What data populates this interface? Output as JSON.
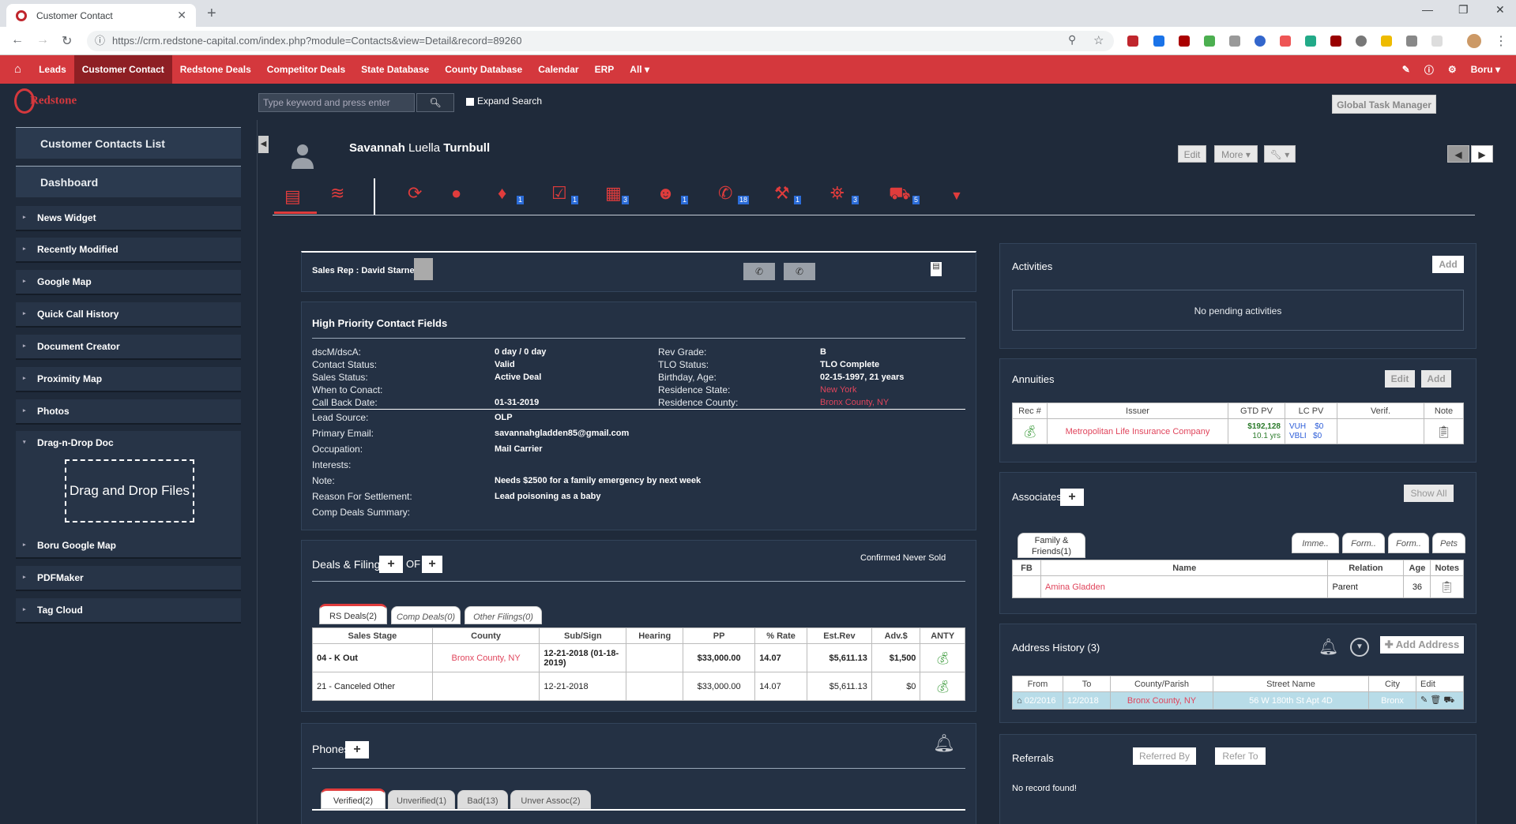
{
  "browser": {
    "tab_title": "Customer Contact",
    "url": "https://crm.redstone-capital.com/index.php?module=Contacts&view=Detail&record=89260"
  },
  "topnav": {
    "items": [
      "Leads",
      "Customer Contact",
      "Redstone Deals",
      "Competitor Deals",
      "State Database",
      "County Database",
      "Calendar",
      "ERP",
      "All"
    ],
    "user": "Boru"
  },
  "search": {
    "placeholder": "Type keyword and press enter",
    "expand_label": "Expand Search",
    "global_task": "Global Task Manager"
  },
  "logo": {
    "text": "Redstone"
  },
  "sidebar": {
    "big": [
      "Customer Contacts List",
      "Dashboard"
    ],
    "items": [
      "News Widget",
      "Recently Modified",
      "Google Map",
      "Quick Call History",
      "Document Creator",
      "Proximity Map",
      "Photos",
      "Drag-n-Drop Doc"
    ],
    "dropzone": "Drag and Drop Files",
    "items2": [
      "Boru Google Map",
      "PDFMaker",
      "Tag Cloud"
    ]
  },
  "contact": {
    "first": "Savannah",
    "middle": "Luella",
    "last": "Turnbull",
    "edit": "Edit",
    "more": "More"
  },
  "iconbar": {
    "badges": [
      "1",
      "1",
      "3",
      "1",
      "18",
      "1",
      "3",
      "5"
    ]
  },
  "salesrep": {
    "label": "Sales Rep : David Starner"
  },
  "hp": {
    "title": "High Priority Contact Fields",
    "left": [
      {
        "label": "dscM/dscA:",
        "value": "0 day / 0 day"
      },
      {
        "label": "Contact Status:",
        "value": "Valid"
      },
      {
        "label": "Sales Status:",
        "value": "Active Deal"
      },
      {
        "label": "When to Conact:",
        "value": ""
      },
      {
        "label": "Call Back Date:",
        "value": "01-31-2019"
      }
    ],
    "right": [
      {
        "label": "Rev Grade:",
        "value": "B"
      },
      {
        "label": "TLO Status:",
        "value": "TLO Complete"
      },
      {
        "label": "Birthday, Age:",
        "value": "02-15-1997, 21 years"
      },
      {
        "label": "Residence State:",
        "value": "New York"
      },
      {
        "label": "Residence County:",
        "value": "Bronx County, NY"
      }
    ],
    "extra": [
      {
        "label": "Lead Source:",
        "value": "OLP"
      },
      {
        "label": "Primary Email:",
        "value": "savannahgladden85@gmail.com"
      },
      {
        "label": "Occupation:",
        "value": "Mail Carrier"
      },
      {
        "label": "Interests:",
        "value": ""
      },
      {
        "label": "Note:",
        "value": "Needs $2500 for a family emergency by next week"
      },
      {
        "label": "Reason For Settlement:",
        "value": "Lead poisoning as a baby"
      },
      {
        "label": "Comp Deals Summary:",
        "value": ""
      }
    ]
  },
  "deals": {
    "title": "Deals & Filings",
    "of": "OF",
    "status": "Confirmed Never Sold",
    "tabs": [
      "RS Deals(2)",
      "Comp Deals(0)",
      "Other Filings(0)"
    ],
    "headers": [
      "Sales Stage",
      "County",
      "Sub/Sign",
      "Hearing",
      "PP",
      "% Rate",
      "Est.Rev",
      "Adv.$",
      "ANTY"
    ],
    "rows": [
      [
        "04 - K Out",
        "Bronx County, NY",
        "12-21-2018 (01-18-2019)",
        "",
        "$33,000.00",
        "14.07",
        "$5,611.13",
        "$1,500"
      ],
      [
        "21 - Canceled Other",
        "",
        "12-21-2018",
        "",
        "$33,000.00",
        "14.07",
        "$5,611.13",
        "$0"
      ]
    ]
  },
  "phones": {
    "title": "Phones",
    "tabs": [
      "Verified(2)",
      "Unverified(1)",
      "Bad(13)",
      "Unver Assoc(2)"
    ]
  },
  "activities": {
    "title": "Activities",
    "add": "Add",
    "empty": "No pending activities"
  },
  "annuities": {
    "title": "Annuities",
    "edit": "Edit",
    "add": "Add",
    "headers": [
      "Rec #",
      "Issuer",
      "GTD PV",
      "LC PV",
      "Verif.",
      "Note"
    ],
    "row": {
      "issuer": "Metropolitan Life Insurance Company",
      "gtd": "$192,128",
      "yrs": "10.1 yrs",
      "lc1": "VUH",
      "lc1v": "$0",
      "lc2": "VBLI",
      "lc2v": "$0"
    }
  },
  "associates": {
    "title": "Associates",
    "show_all": "Show All",
    "tabs": [
      "Family & Friends(1)",
      "Imme..",
      "Form..",
      "Form..",
      "Pets"
    ],
    "headers": [
      "FB",
      "Name",
      "Relation",
      "Age",
      "Notes"
    ],
    "row": {
      "name": "Amina Gladden",
      "relation": "Parent",
      "age": "36"
    }
  },
  "address": {
    "title": "Address History (3)",
    "add": "Add Address",
    "headers": [
      "From",
      "To",
      "County/Parish",
      "Street Name",
      "City",
      "Edit"
    ],
    "row": {
      "from": "02/2016",
      "to": "12/2018",
      "county": "Bronx County, NY",
      "street": "56 W 180th St Apt 4D",
      "city": "Bronx"
    }
  },
  "referrals": {
    "title": "Referrals",
    "by": "Referred By",
    "to": "Refer To",
    "empty": "No record found!"
  },
  "colors": {
    "brand": "#d4383d",
    "bg": "#1f2a3a",
    "accent_red": "#e03c3c"
  }
}
